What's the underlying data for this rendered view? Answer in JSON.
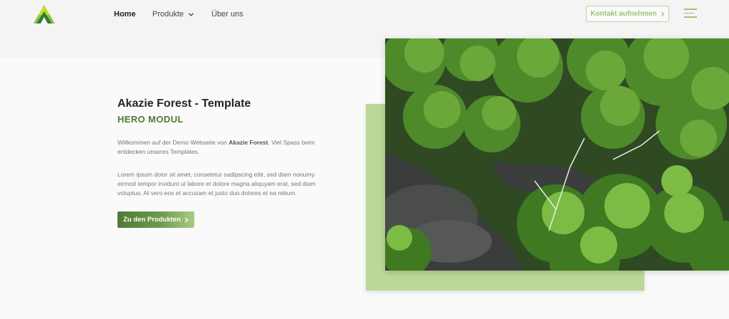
{
  "nav": {
    "items": [
      {
        "label": "Home",
        "active": true
      },
      {
        "label": "Produkte",
        "has_dropdown": true
      },
      {
        "label": "Über uns"
      }
    ],
    "contact_label": "Kontakt aufnehmen"
  },
  "hero": {
    "title": "Akazie Forest - Template",
    "subtitle": "HERO MODUL",
    "intro_prefix": "Willkommen auf der Demo Webseite von ",
    "intro_brand": "Akazie Forest",
    "intro_suffix": ". Viel Spass beim entdecken unseres Templates.",
    "lorem": "Lorem ipsum dolor sit amet, consetetur sadipscing elitr, sed diam nonumy eirmod tempor invidunt ut labore et dolore magna aliquyam erat, sed diam voluptua. At vero eos et accusam et justo duo dolores et ea rebum.",
    "cta_label": "Zu den Produkten"
  },
  "colors": {
    "brand_dark": "#4e7a36",
    "brand_light": "#bcd798",
    "accent_outline": "#9cc476"
  },
  "icons": [
    "logo-icon",
    "chevron-down-icon",
    "chevron-right-icon",
    "hamburger-menu-icon"
  ]
}
